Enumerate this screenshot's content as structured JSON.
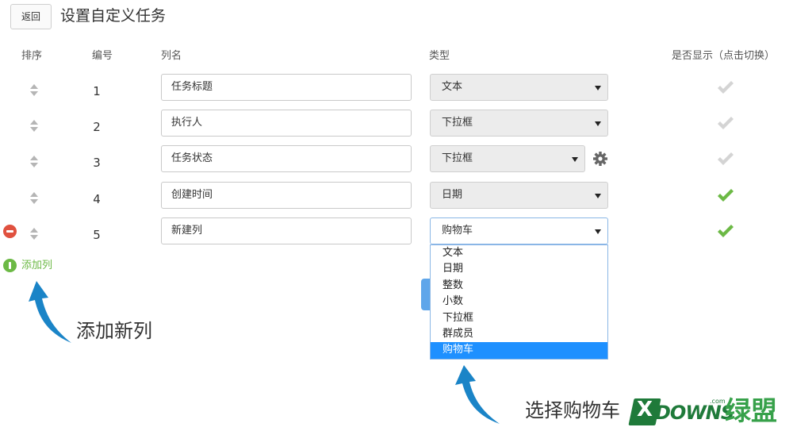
{
  "header": {
    "back_label": "返回",
    "title": "设置自定义任务"
  },
  "columns": {
    "sort": "排序",
    "number": "编号",
    "name": "列名",
    "type": "类型",
    "visible": "是否显示（点击切换）"
  },
  "rows": [
    {
      "number": "1",
      "name": "任务标题",
      "type": "文本",
      "visible": false,
      "has_settings": false,
      "removable": false
    },
    {
      "number": "2",
      "name": "执行人",
      "type": "下拉框",
      "visible": false,
      "has_settings": false,
      "removable": false
    },
    {
      "number": "3",
      "name": "任务状态",
      "type": "下拉框",
      "visible": false,
      "has_settings": true,
      "removable": false
    },
    {
      "number": "4",
      "name": "创建时间",
      "type": "日期",
      "visible": true,
      "has_settings": false,
      "removable": false
    },
    {
      "number": "5",
      "name": "新建列",
      "type": "购物车",
      "visible": true,
      "has_settings": false,
      "removable": true
    }
  ],
  "add_column_label": "添加列",
  "dropdown": {
    "options": [
      "文本",
      "日期",
      "整数",
      "小数",
      "下拉框",
      "群成员",
      "购物车"
    ],
    "selected": "购物车"
  },
  "annotations": {
    "add_new_column": "添加新列",
    "select_cart": "选择购物车"
  },
  "logo": {
    "x": "X",
    "brand": "DOWNS",
    "com": ".com",
    "cn": "绿盟"
  },
  "colors": {
    "check_on": "#6cb945",
    "check_off": "#d4d4d4",
    "remove": "#e0513f",
    "add": "#6cb945",
    "selected_option": "#1e90ff",
    "arrow": "#1a84c7",
    "brand_green": "#1f7a3a"
  }
}
